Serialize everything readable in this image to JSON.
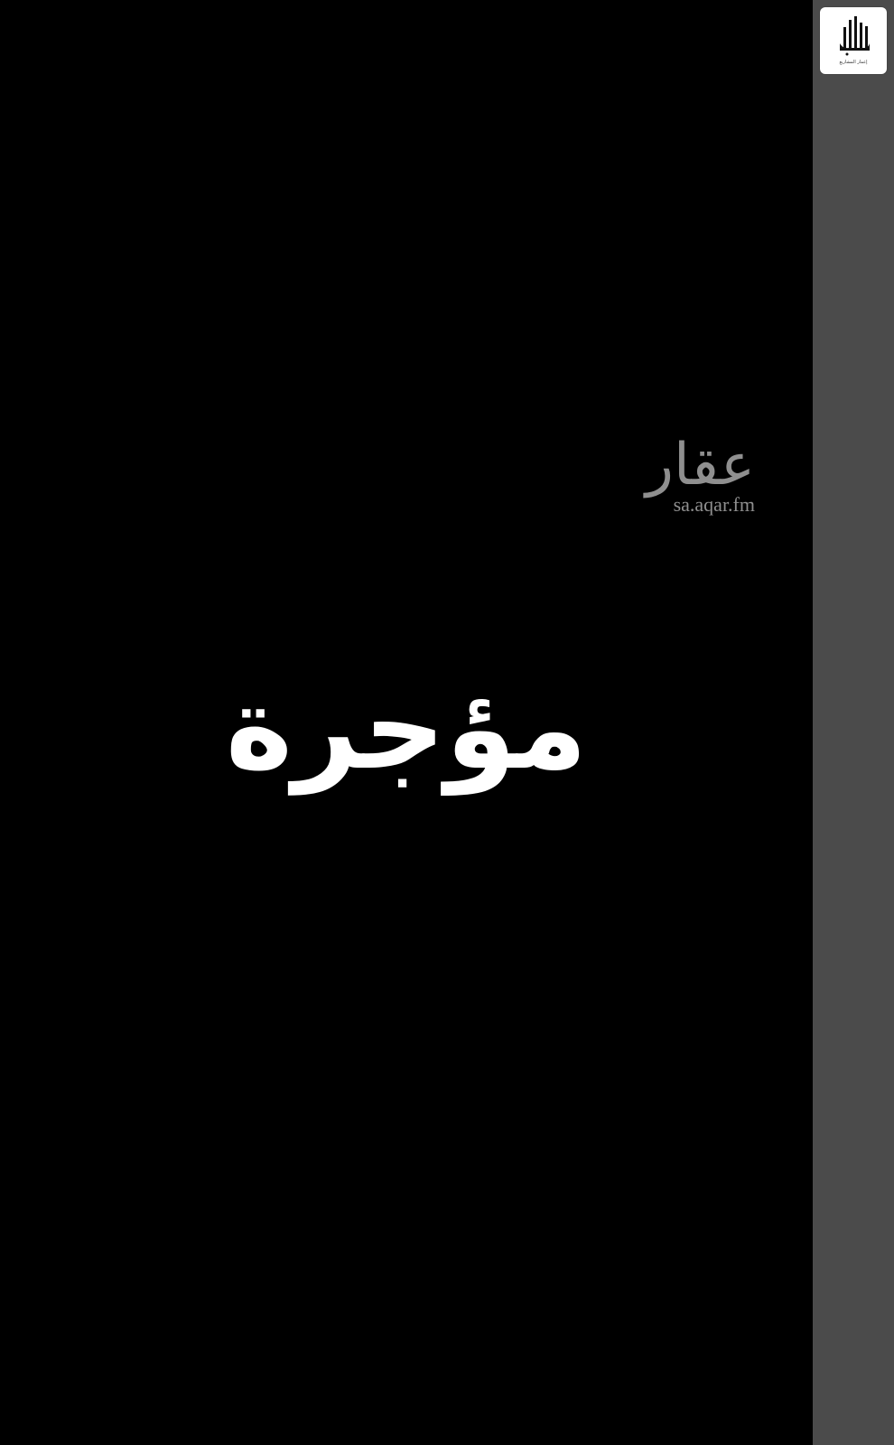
{
  "brand": {
    "logo_icon": "building-towers-logo-icon",
    "logo_caption": "إعمار المشاريع",
    "accent_color": "#4b4b4b",
    "badge_background": "#ffffff"
  },
  "watermark": {
    "arabic": "عقار",
    "domain": "sa.aqar.fm",
    "color": "#8f8f8f"
  },
  "listing": {
    "status": "مؤجرة",
    "status_color": "#ffffff"
  }
}
